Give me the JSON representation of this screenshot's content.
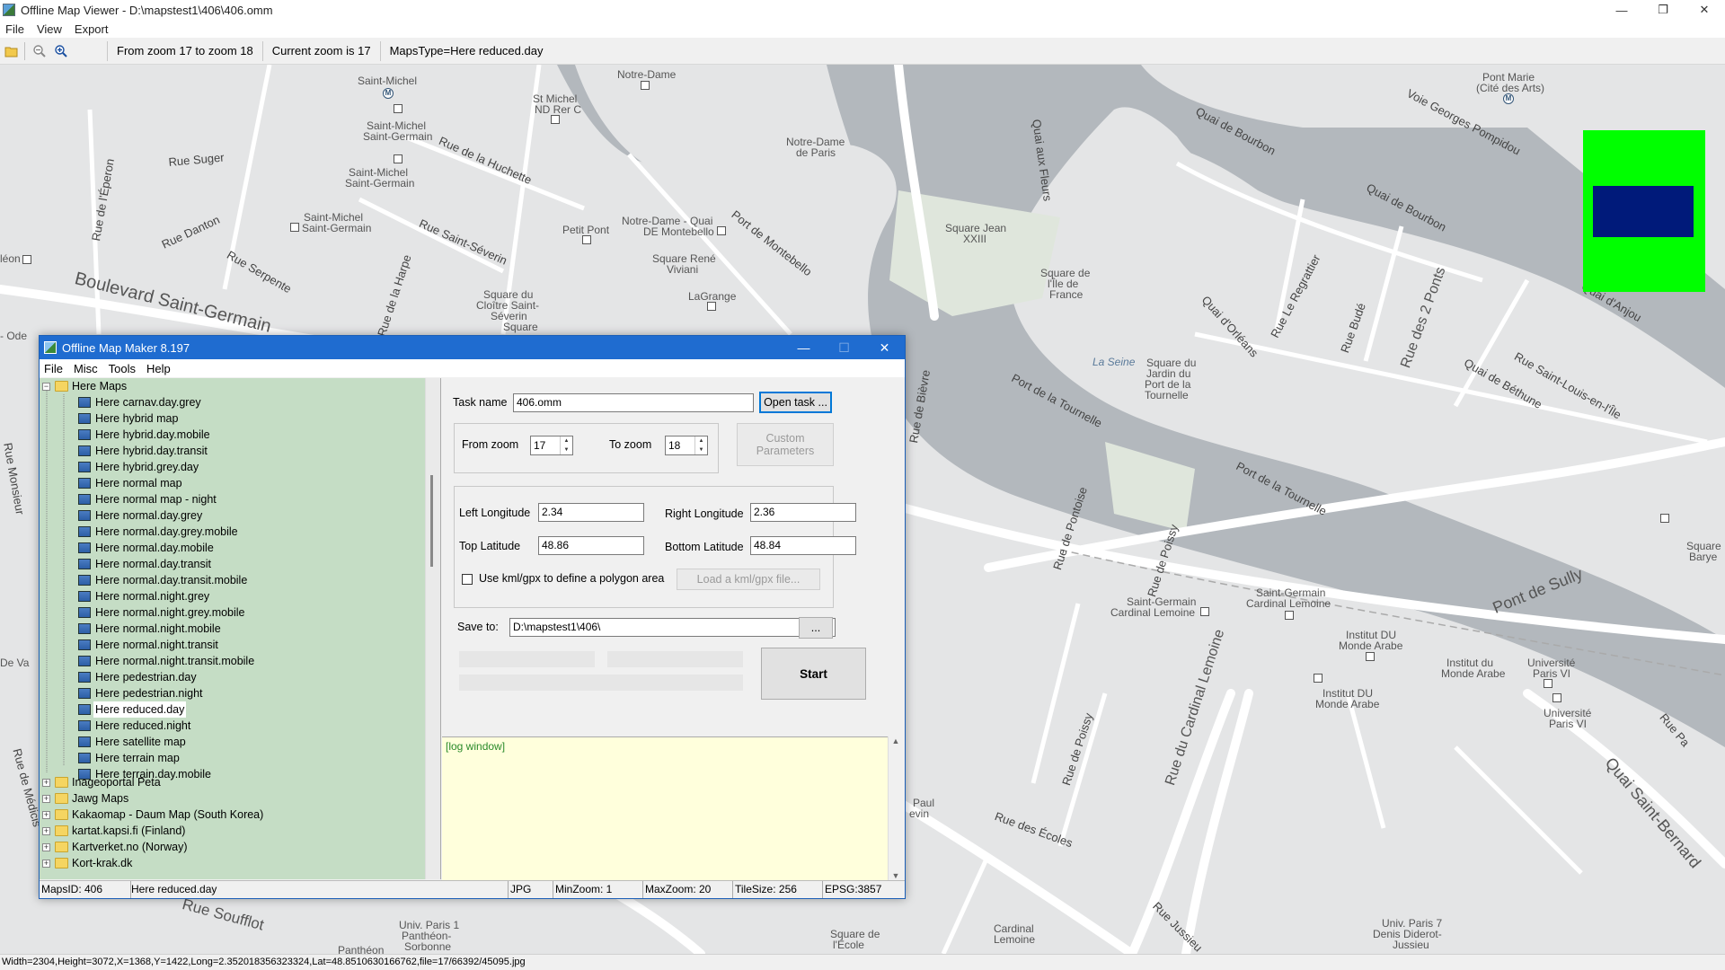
{
  "viewer": {
    "title": "Offline Map Viewer - D:\\mapstest1\\406\\406.omm",
    "window_buttons": {
      "minimize": "—",
      "restore": "❐",
      "close": "✕"
    },
    "menu": [
      "File",
      "View",
      "Export"
    ],
    "toolbar": {
      "info_zoom_range": "From zoom 17 to zoom 18",
      "info_current_zoom": "Current zoom is 17",
      "info_maps_type": "MapsType=Here reduced.day"
    },
    "status": "Width=2304,Height=3072,X=1368,Y=1422,Long=2.352018356323324,Lat=48.8510630166762,file=17/66392/45095.jpg"
  },
  "map": {
    "labels": {
      "saint_michel": "Saint-Michel",
      "notre_dame_top": "Notre-Dame",
      "quai_aux_fleurs": "Quai aux Fleurs",
      "pont_marie": "Pont Marie",
      "pont_marie_sub": "(Cité des Arts)",
      "voie_georges": "Voie Georges Pompidou",
      "st_michel_nd": "St Michel",
      "st_michel_nd_sub": "ND Rer C",
      "quai_bourbon_1": "Quai de Bourbon",
      "quai_bourbon_2": "Quai de Bourbon",
      "saint_michel_sg": "Saint-Michel",
      "saint_michel_sg_sub": "Saint-Germain",
      "rue_huchette": "Rue de la Huchette",
      "notre_dame_paris": "Notre-Dame",
      "notre_dame_paris_sub": "de Paris",
      "rue_suger": "Rue Suger",
      "saint_michel_sg2": "Saint-Michel",
      "saint_michel_sg2_sub": "Saint-Germain",
      "rue_eperon": "Rue de l'Éperon",
      "saint_michel_sg3": "Saint-Michel",
      "saint_michel_sg3_sub": "Saint-Germain",
      "rue_danton": "Rue Danton",
      "rue_saint_severin": "Rue Saint-Séverin",
      "petit_pont": "Petit Pont",
      "notre_dame_quai": "Notre-Dame - Quai",
      "notre_dame_quai_sub": "DE Montebello",
      "port_montebello": "Port de Montebello",
      "square_jean": "Square Jean",
      "square_jean_sub": "XXIII",
      "rue_regrattier": "Rue Le Regrattier",
      "rue_serpente": "Rue Serpente",
      "leon": "léon",
      "square_rene": "Square René",
      "square_rene_sub": "Viviani",
      "square_ile": "Square de",
      "square_ile_sub": "l'Île de",
      "square_ile_sub2": "France",
      "quai_anjou": "Quai d'Anjou",
      "boulevard_sg": "Boulevard Saint-Germain",
      "rue_harpe": "Rue de la Harpe",
      "square_cloitre": "Square du",
      "square_cloitre_sub": "Cloître Saint-",
      "square_cloitre_sub2": "Séverin",
      "square_cloitre_sub3": "Square",
      "lagrange": "LaGrange",
      "rue_bude": "Rue Budé",
      "rue_des_2_ponts": "Rue des 2 Ponts",
      "quai_orleans": "Quai d'Orléans",
      "ode": "- Ode",
      "la_seine": "La Seine",
      "rue_saint_louis": "Rue Saint-Louis-en-l'Île",
      "port_tournelle_1": "Port de la Tournelle",
      "square_jardin": "Square du",
      "square_jardin_sub": "Jardin du",
      "square_jardin_sub2": "Port de la",
      "square_jardin_sub3": "Tournelle",
      "quai_bethune": "Quai de Béthune",
      "rue_monsieur": "Rue Monsieur",
      "rue_bievre": "Rue de Bièvre",
      "rue_pontoise": "Rue de Pontoise",
      "rue_poissy": "Rue de Poissy",
      "port_tournelle_2": "Port de la Tournelle",
      "square_barye": "Square",
      "square_barye_sub": "Barye",
      "pont_sully": "Pont de Sully",
      "saint_germain_cl1": "Saint-Germain",
      "saint_germain_cl1_sub": "Cardinal Lemoine",
      "saint_germain_cl2": "Saint-Germain",
      "saint_germain_cl2_sub": "Cardinal Lemoine",
      "rue_va": "De Va",
      "institut_1": "Institut DU",
      "institut_1_sub": "Monde Arabe",
      "institut_2": "Institut du",
      "institut_2_sub": "Monde Arabe",
      "universite_1": "Université",
      "universite_1_sub": "Paris VI",
      "institut_3": "Institut DU",
      "institut_3_sub": "Monde Arabe",
      "rue_poissy_2": "Rue de Poissy",
      "universite_2": "Université",
      "universite_2_sub": "Paris VI",
      "rue_cardinal": "Rue du Cardinal Lemoine",
      "medicis": "Rue de Médicis",
      "paul_levin": "Paul",
      "paul_levin_sub": "evin",
      "rue_ecoles": "Rue des Écoles",
      "quai_saint_bernard": "Quai Saint-Bernard",
      "rue_soufflot": "Rue Soufflot",
      "rue_jussieu": "Rue Jussieu",
      "univ_paris1": "Univ. Paris 1",
      "univ_paris1_sub": "Panthéon-",
      "univ_paris1_sub2": "Sorbonne",
      "pantheon": "Panthéon",
      "square_ecole": "Square de",
      "square_ecole_sub": "l'École",
      "cardinal_lemoine": "Cardinal",
      "cardinal_lemoine_sub": "Lemoine",
      "univ_paris7": "Univ. Paris 7",
      "univ_paris7_sub": "Denis Diderot-",
      "univ_paris7_sub2": "Jussieu",
      "rue_pa": "Rue Pa"
    }
  },
  "maker": {
    "title": "Offline Map Maker 8.197",
    "window_buttons": {
      "minimize": "—",
      "maximize": "☐",
      "close": "✕"
    },
    "menu": [
      "File",
      "Misc",
      "Tools",
      "Help"
    ],
    "tree": {
      "root": "Here Maps",
      "children": [
        "Here carnav.day.grey",
        "Here hybrid map",
        "Here hybrid.day.mobile",
        "Here hybrid.day.transit",
        "Here hybrid.grey.day",
        "Here normal map",
        "Here normal map - night",
        "Here normal.day.grey",
        "Here normal.day.grey.mobile",
        "Here normal.day.mobile",
        "Here normal.day.transit",
        "Here normal.day.transit.mobile",
        "Here normal.night.grey",
        "Here normal.night.grey.mobile",
        "Here normal.night.mobile",
        "Here normal.night.transit",
        "Here normal.night.transit.mobile",
        "Here pedestrian.day",
        "Here pedestrian.night",
        "Here reduced.day",
        "Here reduced.night",
        "Here satellite map",
        "Here terrain map",
        "Here terrain.day.mobile"
      ],
      "selected": "Here reduced.day",
      "siblings": [
        "Inageoportal Peta",
        "Jawg Maps",
        "Kakaomap - Daum Map (South Korea)",
        "kartat.kapsi.fi (Finland)",
        "Kartverket.no (Norway)",
        "Kort-krak.dk"
      ]
    },
    "form": {
      "task_name_label": "Task name",
      "task_name_value": "406.omm",
      "open_task_button": "Open task ...",
      "from_zoom_label": "From zoom",
      "from_zoom_value": "17",
      "to_zoom_label": "To zoom",
      "to_zoom_value": "18",
      "custom_params_button": "Custom Parameters",
      "left_long_label": "Left Longitude",
      "left_long_value": "2.34",
      "right_long_label": "Right Longitude",
      "right_long_value": "2.36",
      "top_lat_label": "Top Latitude",
      "top_lat_value": "48.86",
      "bottom_lat_label": "Bottom Latitude",
      "bottom_lat_value": "48.84",
      "kml_checkbox_label": "Use kml/gpx to define a polygon area",
      "load_kml_button": "Load a kml/gpx file...",
      "save_to_label": "Save to:",
      "save_to_value": "D:\\mapstest1\\406\\",
      "browse_button": "...",
      "start_button": "Start"
    },
    "log": "[log window]",
    "status": {
      "maps_id": "MapsID: 406",
      "maps_name": "Here reduced.day",
      "format": "JPG",
      "min_zoom": "MinZoom: 1",
      "max_zoom": "MaxZoom: 20",
      "tile_size": "TileSize: 256",
      "epsg": "EPSG:3857"
    }
  },
  "colors": {
    "map_background": "#e4e5e6",
    "map_water": "#b3b8bd",
    "map_road": "#ffffff",
    "overview_bg": "#00ff00",
    "overview_view": "#001a7a",
    "tree_bg": "#c5ddc5",
    "log_bg": "#ffffdc",
    "title_active": "#1f6cd0"
  }
}
